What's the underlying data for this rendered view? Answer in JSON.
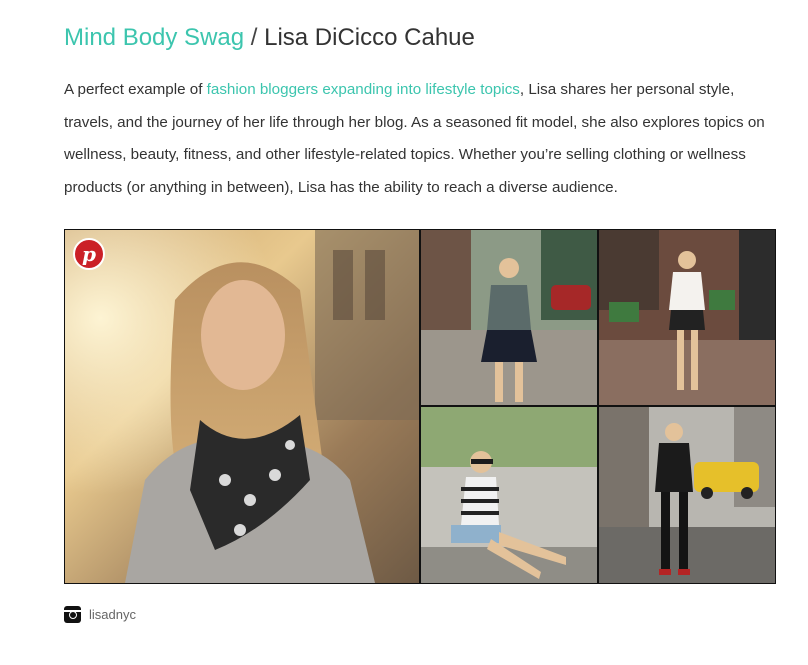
{
  "header": {
    "brand": "Mind Body Swag",
    "separator": " / ",
    "name": "Lisa DiCicco Cahue"
  },
  "description": {
    "before_link": "A perfect example of ",
    "link_text": "fashion bloggers expanding into lifestyle topics",
    "after_link": ", Lisa shares her personal style, travels, and the journey of her life through her blog. As a seasoned fit model, she also explores topics on wellness, beauty, fitness, and other lifestyle-related topics. Whether you’re selling clothing or wellness products (or anything in between), Lisa has the ability to reach a diverse audience."
  },
  "gallery": {
    "photos": [
      {
        "subject": "portrait-with-skull-scarf"
      },
      {
        "subject": "street-camo-top-skirt"
      },
      {
        "subject": "stoop-white-shirt-gladiators"
      },
      {
        "subject": "sitting-curb-striped-top"
      },
      {
        "subject": "street-black-outfit-taxi"
      }
    ],
    "pin_icon": "pinterest-icon"
  },
  "instagram": {
    "icon": "instagram-icon",
    "handle": "lisadnyc"
  },
  "colors": {
    "accent": "#3cc5ae",
    "text": "#333333",
    "pinterest": "#cb2027"
  }
}
